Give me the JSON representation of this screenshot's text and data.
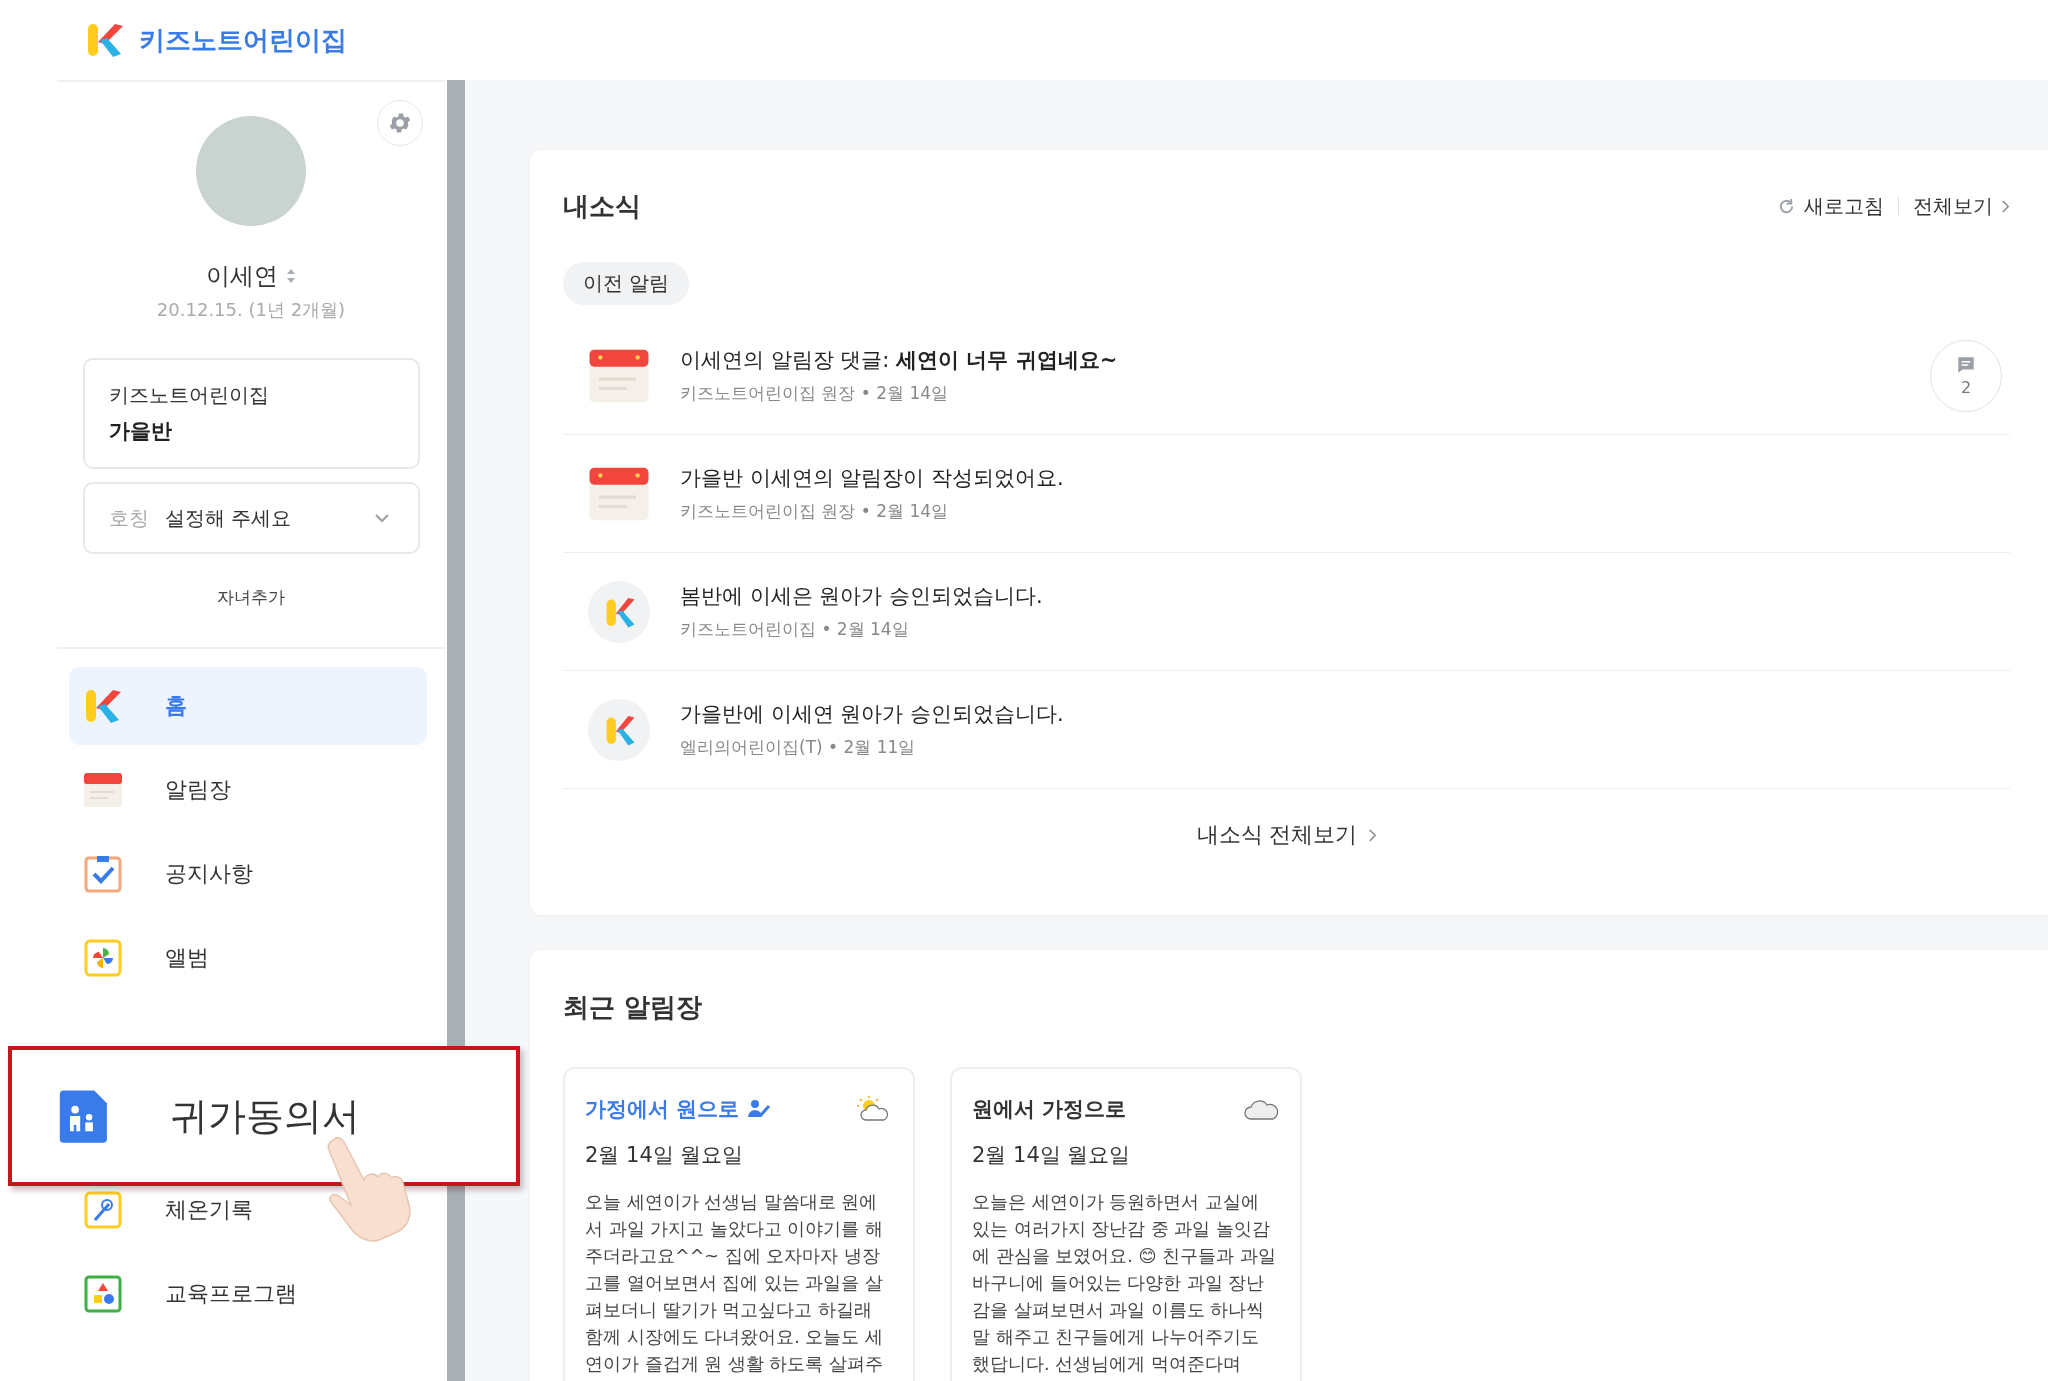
{
  "header": {
    "app_name": "키즈노트어린이집"
  },
  "profile": {
    "name": "이세연",
    "birth": "20.12.15. (1년 2개월)",
    "school": "키즈노트어린이집",
    "class": "가을반",
    "nickname": {
      "label": "호칭",
      "placeholder": "설정해 주세요"
    },
    "add_child": "자녀추가"
  },
  "menu": [
    {
      "label": "홈",
      "kind": "home",
      "selected": true
    },
    {
      "label": "알림장",
      "kind": "notebook",
      "selected": false
    },
    {
      "label": "공지사항",
      "kind": "notice",
      "selected": false
    },
    {
      "label": "앨범",
      "kind": "album",
      "selected": false
    },
    {
      "label": "체온기록",
      "kind": "temperature",
      "selected": false
    },
    {
      "label": "교육프로그램",
      "kind": "education",
      "selected": false
    }
  ],
  "callout": {
    "label": "귀가동의서"
  },
  "news": {
    "title": "내소식",
    "refresh": "새로고침",
    "view_all": "전체보기",
    "chip": "이전 알림",
    "items": [
      {
        "kind": "notebook",
        "title": "이세연의 알림장 댓글: **세연이 너무 귀엽네요~**",
        "meta": "키즈노트어린이집 원장 • 2월 14일",
        "comments": "2"
      },
      {
        "kind": "notebook",
        "title": "가을반 이세연의 알림장이 작성되었어요.",
        "meta": "키즈노트어린이집 원장 • 2월 14일"
      },
      {
        "kind": "approval",
        "title": "봄반에 이세은 원아가 승인되었습니다.",
        "meta": "키즈노트어린이집 • 2월 14일"
      },
      {
        "kind": "approval",
        "title": "가을반에 이세연 원아가 승인되었습니다.",
        "meta": "엘리의어린이집(T) • 2월 11일"
      }
    ],
    "footer": "내소식 전체보기"
  },
  "recent": {
    "title": "최근 알림장",
    "notes": [
      {
        "kind": "to_school",
        "title": "가정에서 원으로",
        "date": "2월 14일 월요일",
        "body": "오늘 세연이가 선생님 말씀대로 원에서 과일 가지고 놀았다고 이야기를 해주더라고요^^~ 집에 오자마자 냉장고를 열어보면서 집에 있는 과일을 살펴보더니 딸기가 먹고싶다고 하길래 함께 시장에도 다녀왔어요. 오늘도 세연이가 즐겁게 원 생활 하도록 살펴주"
      },
      {
        "kind": "to_home",
        "title": "원에서 가정으로",
        "date": "2월 14일 월요일",
        "body": "오늘은 세연이가 등원하면서 교실에 있는 여러가지 장난감 중 과일 놀잇감에 관심을 보였어요. 😊 친구들과 과일 바구니에 들어있는 다양한 과일 장난감을 살펴보면서 과일 이름도 하나씩 말 해주고 친구들에게 나누어주기도 했답니다. 선생님에게 먹여준다며"
      }
    ]
  }
}
